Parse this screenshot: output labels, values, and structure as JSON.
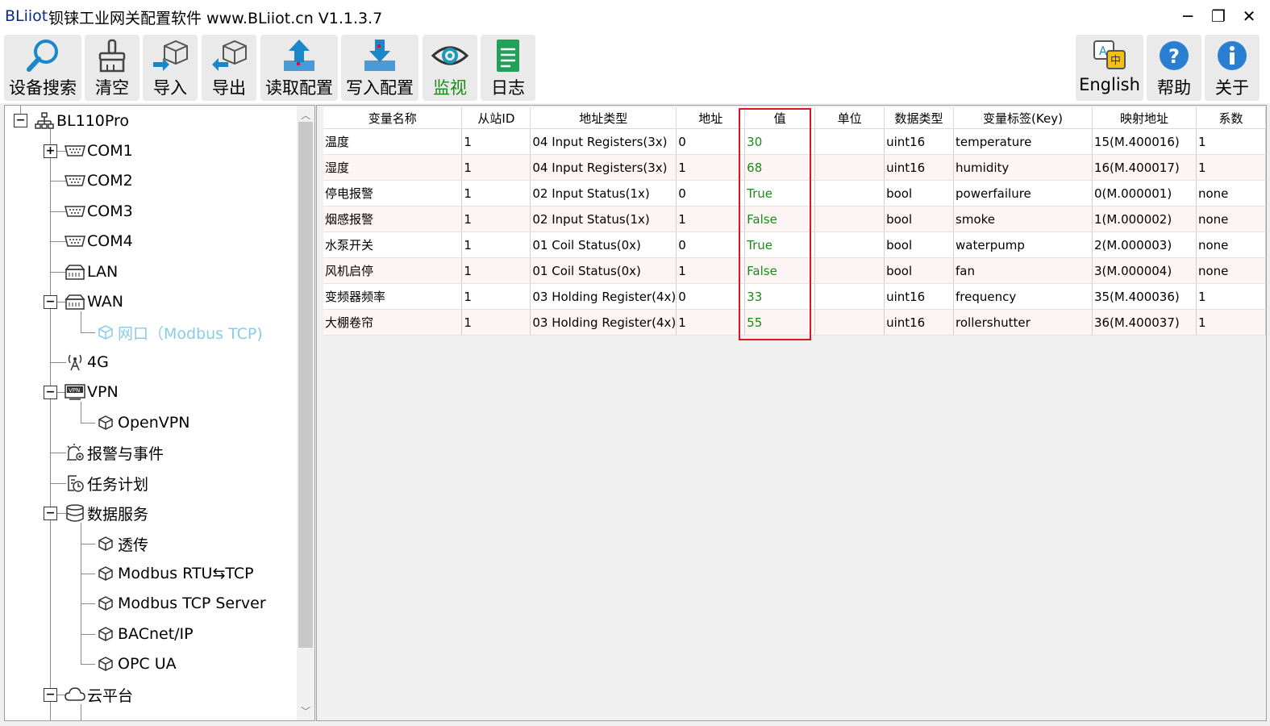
{
  "window": {
    "brand": "BLiiot",
    "title": "钡铼工业网关配置软件 www.BLiiot.cn V1.1.3.7",
    "minimize": "─",
    "restore": "❐",
    "close": "✕"
  },
  "toolbar": {
    "left": [
      {
        "label": "设备搜索",
        "icon": "magnifier-icon"
      },
      {
        "label": "清空",
        "icon": "brush-icon"
      },
      {
        "label": "导入",
        "icon": "import-cube-icon"
      },
      {
        "label": "导出",
        "icon": "export-cube-icon"
      },
      {
        "label": "读取配置",
        "icon": "upload-arrow-icon"
      },
      {
        "label": "写入配置",
        "icon": "download-arrow-icon"
      },
      {
        "label": "监视",
        "icon": "eye-icon",
        "active": true
      },
      {
        "label": "日志",
        "icon": "document-icon"
      }
    ],
    "right": [
      {
        "label": "English",
        "icon": "language-icon"
      },
      {
        "label": "帮助",
        "icon": "help-icon"
      },
      {
        "label": "关于",
        "icon": "info-icon"
      }
    ],
    "accent_color": "#1a8a1a"
  },
  "tree": {
    "root": "BL110Pro",
    "items": [
      {
        "label": "COM1",
        "icon": "serial-port-icon"
      },
      {
        "label": "COM2",
        "icon": "serial-port-icon"
      },
      {
        "label": "COM3",
        "icon": "serial-port-icon"
      },
      {
        "label": "COM4",
        "icon": "serial-port-icon"
      },
      {
        "label": "LAN",
        "icon": "lan-icon"
      },
      {
        "label": "WAN",
        "icon": "lan-icon"
      },
      {
        "label": "网口（Modbus TCP)",
        "icon": "cube-icon",
        "selected": true
      },
      {
        "label": "4G",
        "icon": "antenna-icon"
      },
      {
        "label": "VPN",
        "icon": "vpn-icon"
      },
      {
        "label": "OpenVPN",
        "icon": "cube-icon"
      },
      {
        "label": "报警与事件",
        "icon": "alarm-icon"
      },
      {
        "label": "任务计划",
        "icon": "schedule-icon"
      },
      {
        "label": "数据服务",
        "icon": "database-icon"
      },
      {
        "label": "透传",
        "icon": "cube-icon"
      },
      {
        "label": "Modbus RTU⇆TCP",
        "icon": "cube-icon"
      },
      {
        "label": "Modbus TCP Server",
        "icon": "cube-icon"
      },
      {
        "label": "BACnet/IP",
        "icon": "cube-icon"
      },
      {
        "label": "OPC UA",
        "icon": "cube-icon"
      },
      {
        "label": "云平台",
        "icon": "cloud-icon"
      }
    ],
    "selected_color": "#87cde8"
  },
  "table": {
    "columns": [
      "变量名称",
      "从站ID",
      "地址类型",
      "地址",
      "值",
      "单位",
      "数据类型",
      "变量标签(Key)",
      "映射地址",
      "系数"
    ],
    "rows": [
      [
        "温度",
        "1",
        "04 Input Registers(3x)",
        "0",
        "30",
        "",
        "uint16",
        "temperature",
        "15(M.400016)",
        "1"
      ],
      [
        "湿度",
        "1",
        "04 Input Registers(3x)",
        "1",
        "68",
        "",
        "uint16",
        "humidity",
        "16(M.400017)",
        "1"
      ],
      [
        "停电报警",
        "1",
        "02 Input Status(1x)",
        "0",
        "True",
        "",
        "bool",
        "powerfailure",
        "0(M.000001)",
        "none"
      ],
      [
        "烟感报警",
        "1",
        "02 Input Status(1x)",
        "1",
        "False",
        "",
        "bool",
        "smoke",
        "1(M.000002)",
        "none"
      ],
      [
        "水泵开关",
        "1",
        "01 Coil Status(0x)",
        "0",
        "True",
        "",
        "bool",
        "waterpump",
        "2(M.000003)",
        "none"
      ],
      [
        "风机启停",
        "1",
        "01 Coil Status(0x)",
        "1",
        "False",
        "",
        "bool",
        "fan",
        "3(M.000004)",
        "none"
      ],
      [
        "变频器频率",
        "1",
        "03 Holding Register(4x)",
        "0",
        "33",
        "",
        "uint16",
        "frequency",
        "35(M.400036)",
        "1"
      ],
      [
        "大棚卷帘",
        "1",
        "03 Holding Register(4x)",
        "1",
        "55",
        "",
        "uint16",
        "rollershutter",
        "36(M.400037)",
        "1"
      ]
    ],
    "value_color": "#1a8a1a",
    "highlight_color": "#e0141c"
  }
}
